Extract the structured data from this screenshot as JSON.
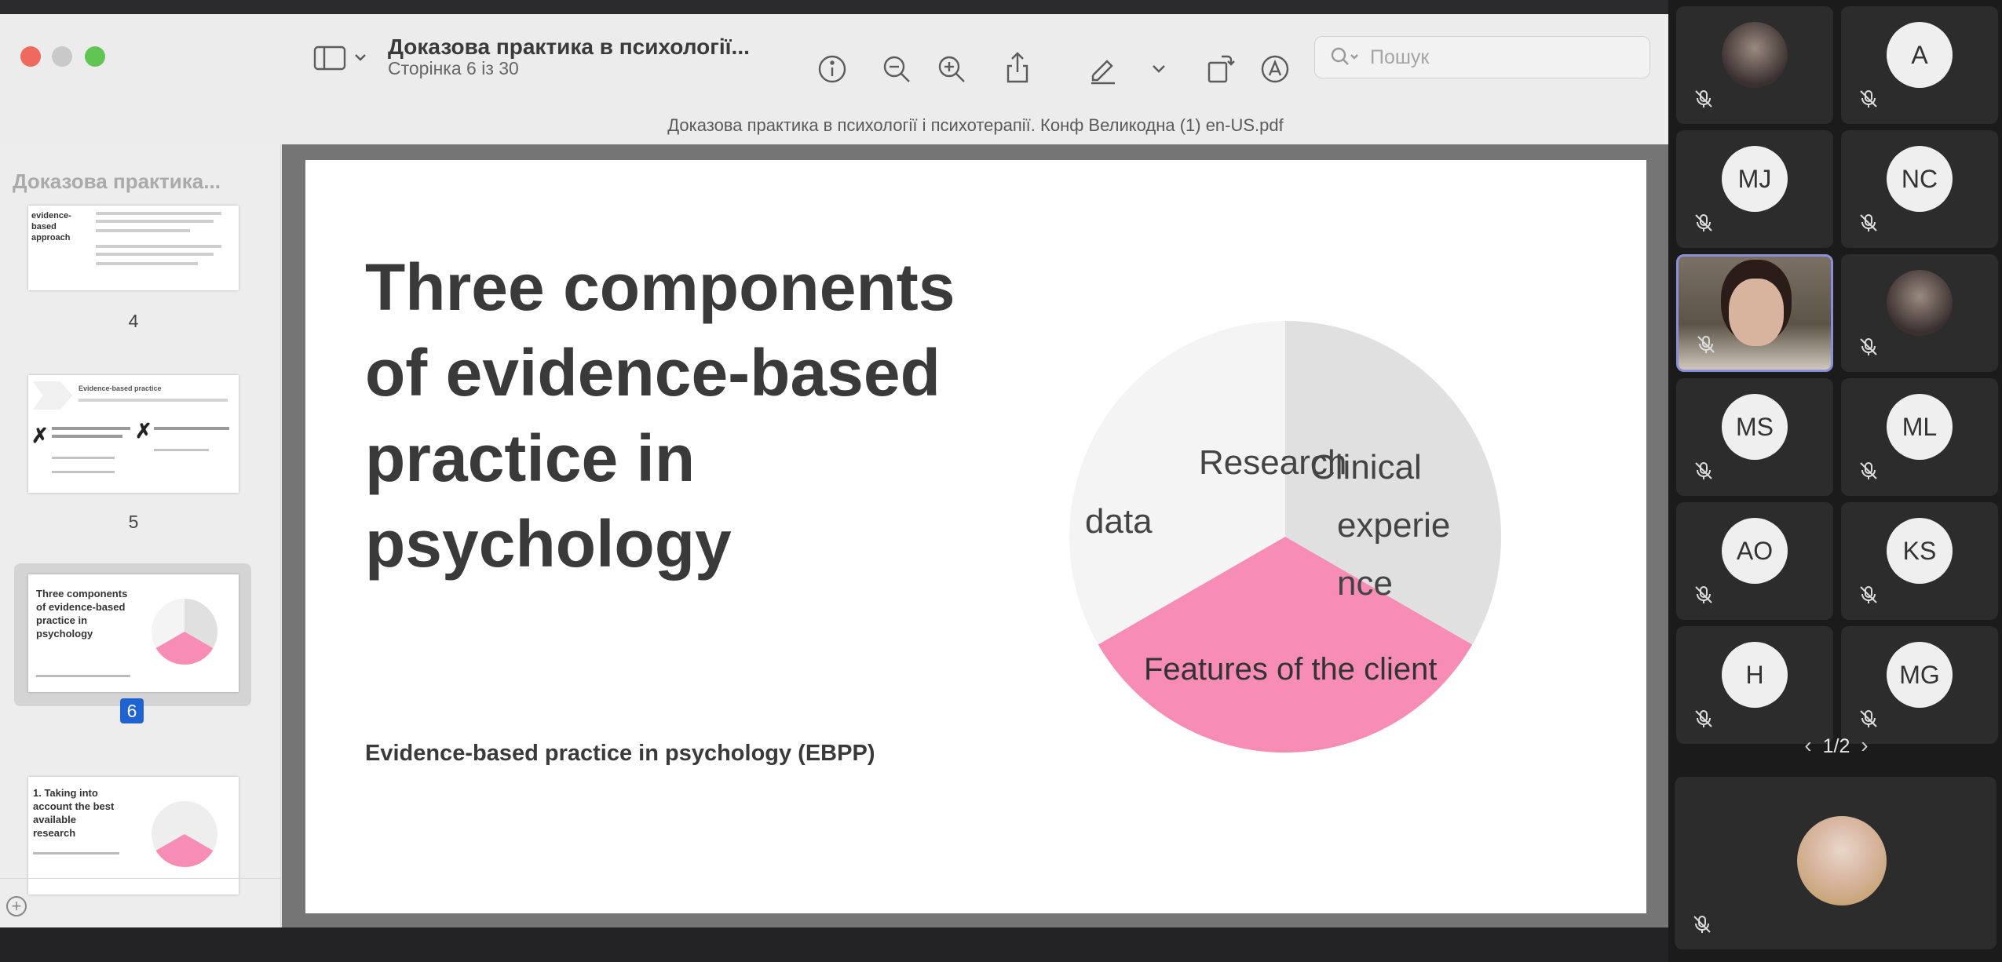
{
  "viewer": {
    "doc_title": "Доказова практика в психології...",
    "doc_page": "Сторінка 6 із 30",
    "filename": "Доказова практика в психології і психотерапії. Конф Великодна (1) en-US.pdf",
    "search_placeholder": "Пошук",
    "sidebar_title": "Доказова практика..."
  },
  "thumbnails": [
    {
      "page": "4",
      "text": "evidence-based approach"
    },
    {
      "page": "5",
      "text": "Evidence-based practice"
    },
    {
      "page": "6",
      "text": "Three components of evidence-based practice in psychology"
    },
    {
      "page": "",
      "text": "1. Taking into account the best available research"
    }
  ],
  "slide": {
    "title": "Three components of evidence-based practice in psychology",
    "subtitle": "Evidence-based practice in psychology (EBPP)",
    "pie_labels": {
      "research": [
        "Research",
        "data"
      ],
      "clinical": [
        "Clinical",
        "experie",
        "nce"
      ],
      "client": "Features of the client"
    },
    "colors": {
      "research": "#f4f4f4",
      "clinical": "#e0e0e0",
      "client": "#f78db4"
    }
  },
  "participants": [
    {
      "label": "",
      "photo": true
    },
    {
      "label": "A"
    },
    {
      "label": "MJ"
    },
    {
      "label": "NC"
    },
    {
      "label": "",
      "photo": true,
      "active": true
    },
    {
      "label": "",
      "photo": true
    },
    {
      "label": "MS"
    },
    {
      "label": "ML"
    },
    {
      "label": "AO"
    },
    {
      "label": "KS"
    },
    {
      "label": "H"
    },
    {
      "label": "MG"
    }
  ],
  "pager": {
    "text": "1/2"
  }
}
